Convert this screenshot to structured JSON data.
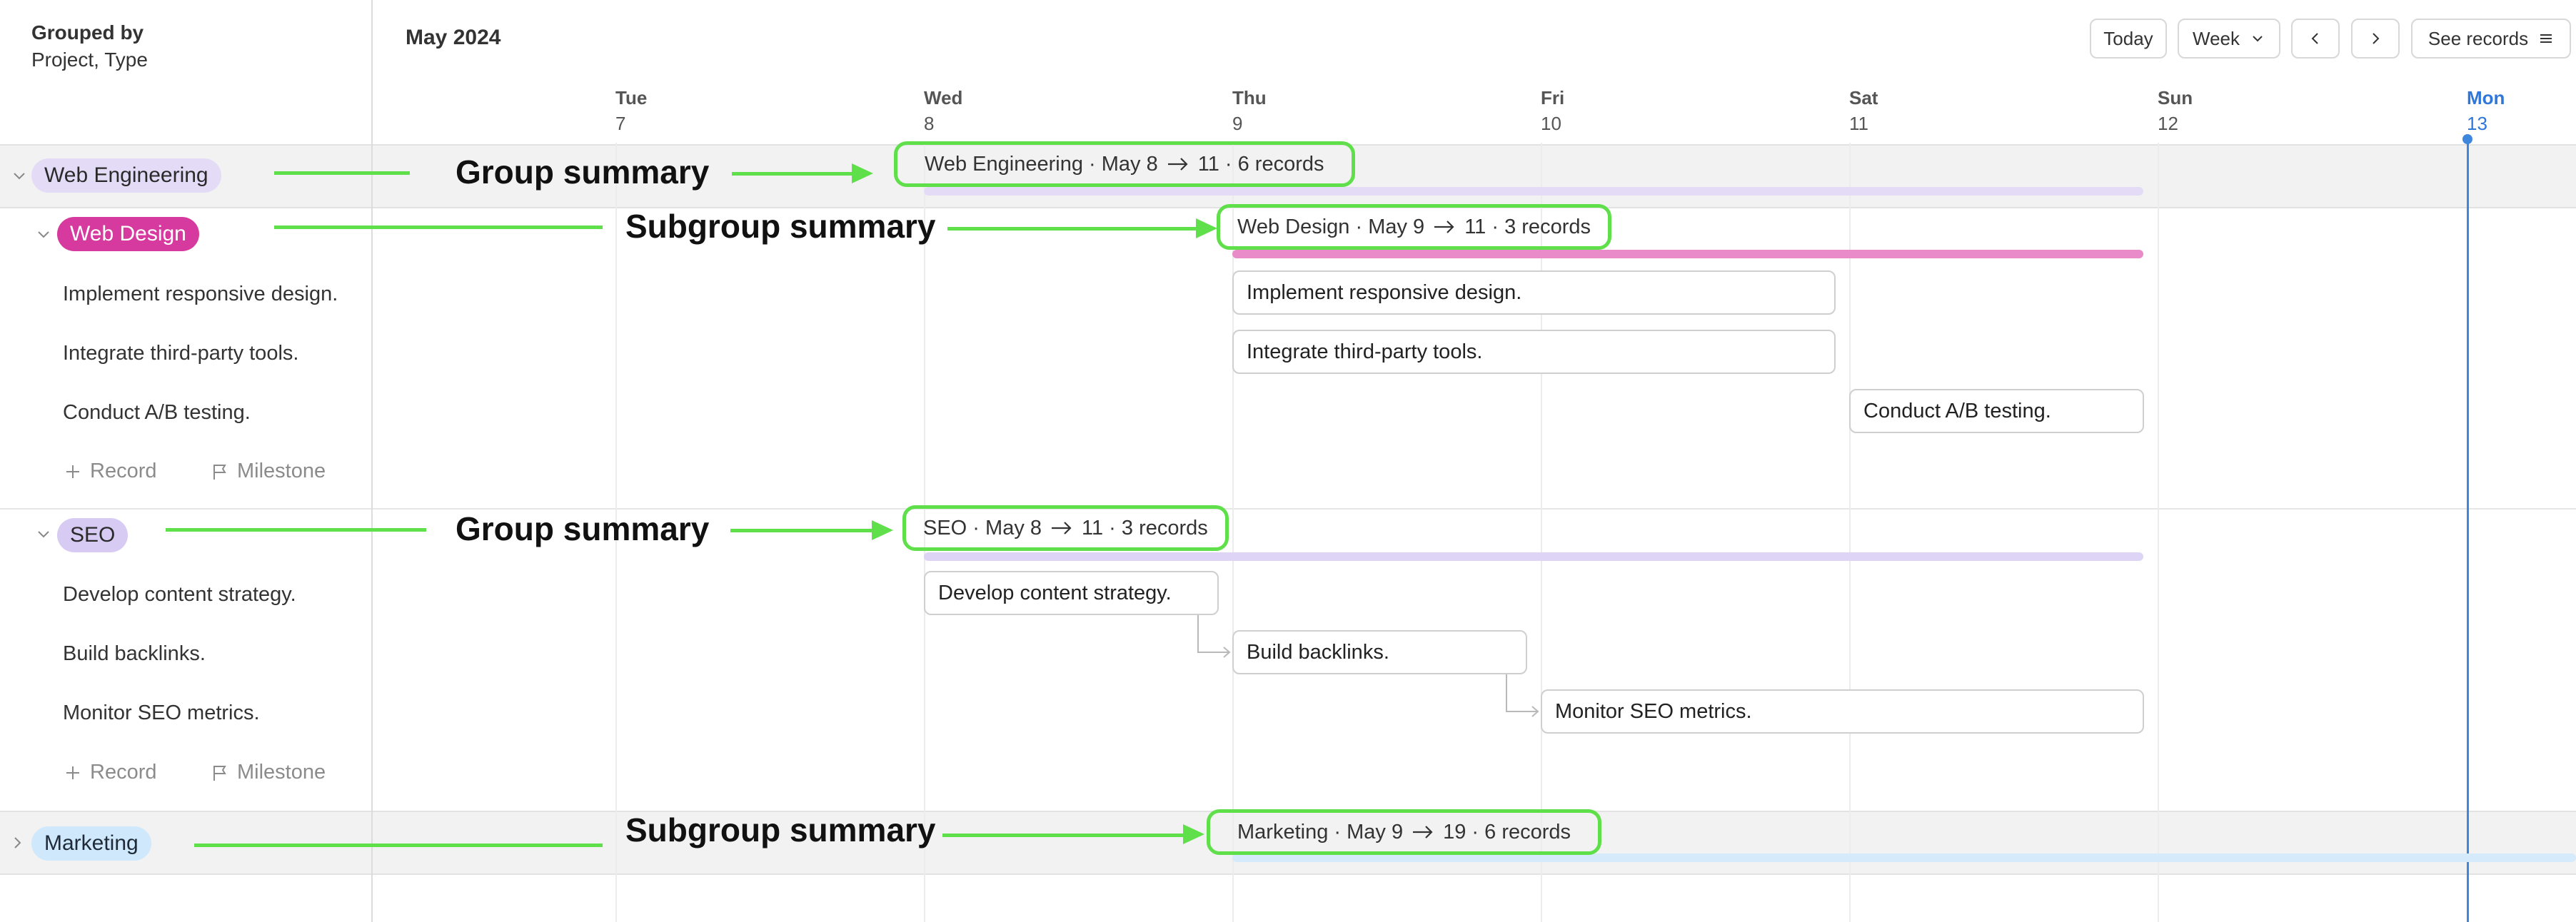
{
  "sidebar": {
    "grouped_title": "Grouped by",
    "grouped_fields": "Project, Type",
    "add_record_label": "Record",
    "add_milestone_label": "Milestone"
  },
  "header": {
    "month": "May 2024",
    "today_label": "Today",
    "view_label": "Week",
    "see_records_label": "See records",
    "days": [
      {
        "name": "Tue",
        "num": "7"
      },
      {
        "name": "Wed",
        "num": "8"
      },
      {
        "name": "Thu",
        "num": "9"
      },
      {
        "name": "Fri",
        "num": "10"
      },
      {
        "name": "Sat",
        "num": "11"
      },
      {
        "name": "Sun",
        "num": "12"
      },
      {
        "name": "Mon",
        "num": "13"
      }
    ],
    "today_index": 6
  },
  "groups": {
    "web_engineering": {
      "label": "Web Engineering",
      "summary_name": "Web Engineering",
      "summary_start": "May 8",
      "summary_end": "11",
      "summary_count": "6 records",
      "subgroup": {
        "label": "Web Design",
        "summary_name": "Web Design",
        "summary_start": "May 9",
        "summary_end": "11",
        "summary_count": "3 records",
        "tasks": [
          "Implement responsive design.",
          "Integrate third-party tools.",
          "Conduct A/B testing."
        ]
      }
    },
    "seo": {
      "label": "SEO",
      "summary_name": "SEO",
      "summary_start": "May 8",
      "summary_end": "11",
      "summary_count": "3 records",
      "tasks": [
        "Develop content strategy.",
        "Build backlinks.",
        "Monitor SEO metrics."
      ]
    },
    "marketing": {
      "label": "Marketing",
      "summary_name": "Marketing",
      "summary_start": "May 9",
      "summary_end": "19",
      "summary_count": "6 records"
    }
  },
  "annotations": {
    "group_summary": "Group summary",
    "subgroup_summary": "Subgroup summary"
  },
  "colors": {
    "annotation_green": "#5fe04a",
    "today_blue": "#3f86dd",
    "web_design_pink": "#d63a9e",
    "web_engineering_lavender": "#e4dcf7",
    "seo_lavender": "#d7cbf4",
    "marketing_blue": "#cfe8fb"
  }
}
